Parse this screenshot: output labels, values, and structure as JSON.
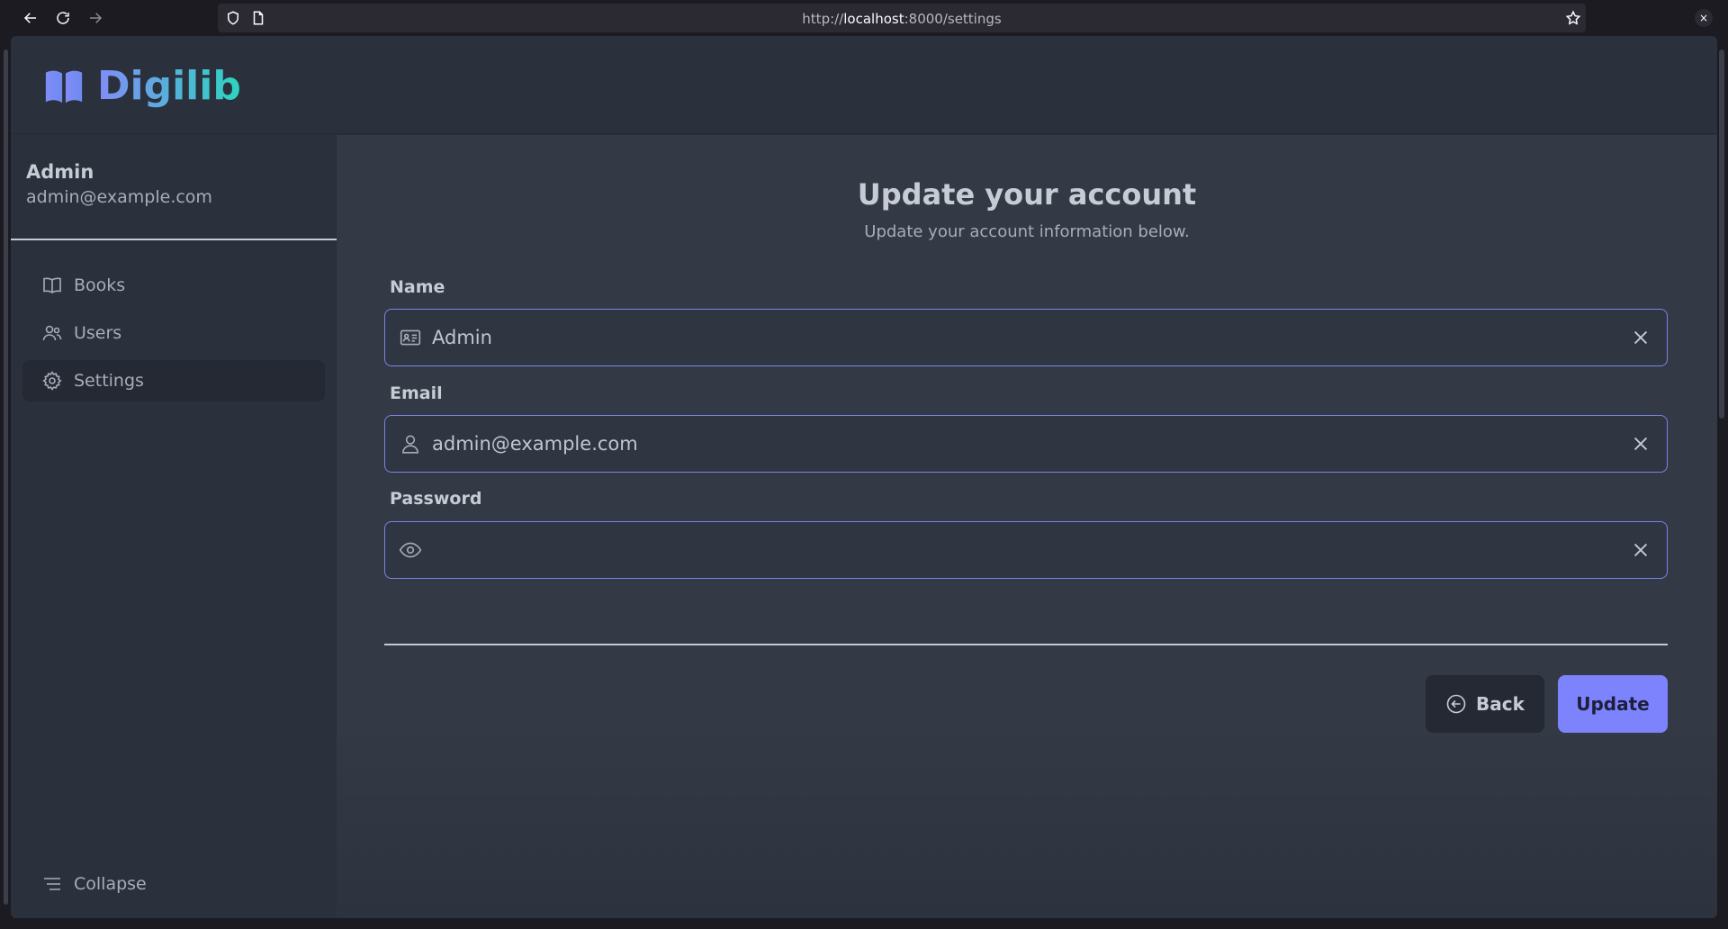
{
  "browser": {
    "url_prefix": "http://",
    "url_host": "localhost",
    "url_rest": ":8000/settings",
    "close_label": "×"
  },
  "app": {
    "logo_text": "Digilib",
    "brand_colors": [
      "#818cf8",
      "#2dd4bf"
    ]
  },
  "sidebar": {
    "user_name": "Admin",
    "user_email": "admin@example.com",
    "items": [
      {
        "label": "Books",
        "icon": "book-open-icon"
      },
      {
        "label": "Users",
        "icon": "users-icon"
      },
      {
        "label": "Settings",
        "icon": "gear-icon",
        "active": true
      }
    ],
    "collapse_label": "Collapse"
  },
  "form": {
    "title": "Update your account",
    "subtitle": "Update your account information below.",
    "name_label": "Name",
    "name_value": "Admin",
    "email_label": "Email",
    "email_value": "admin@example.com",
    "password_label": "Password",
    "password_value": "",
    "back_label": "Back",
    "update_label": "Update",
    "accent_color": "#7c83fd"
  }
}
